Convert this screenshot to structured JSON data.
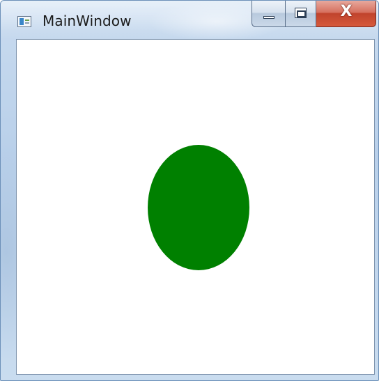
{
  "window": {
    "title": "MainWindow",
    "icon": "window-app-icon",
    "controls": {
      "minimize": "minimize-icon",
      "maximize": "maximize-icon",
      "close": "close-icon",
      "close_glyph": "X"
    }
  },
  "canvas": {
    "background": "#ffffff",
    "shape": {
      "kind": "ellipse",
      "fill": "#008000"
    }
  }
}
